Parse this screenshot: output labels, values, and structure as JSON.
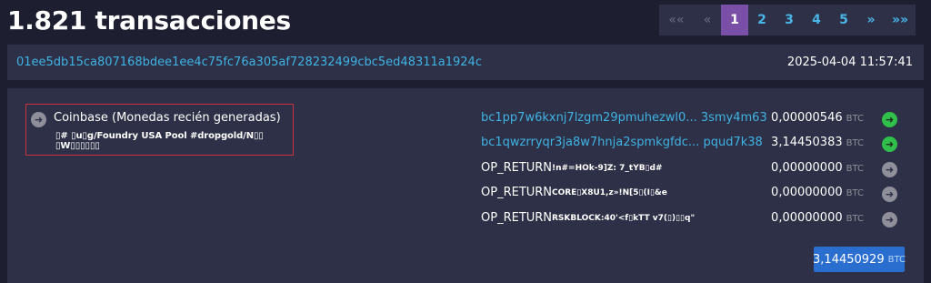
{
  "header": {
    "title": "1.821 transacciones"
  },
  "pagination": {
    "first": "««",
    "prev": "«",
    "pages": [
      "1",
      "2",
      "3",
      "4",
      "5"
    ],
    "active_page": "1",
    "next": "»",
    "last": "»»"
  },
  "transaction": {
    "txid": "01ee5db15ca807168bdee1ee4c75fc76a305af728232499cbc5ed48311a1924c",
    "timestamp": "2025-04-04 11:57:41",
    "input": {
      "label": "Coinbase (Monedas recién generadas)",
      "script": "▯# ▯u▯g/Foundry USA Pool #dropgold/N▯▯ ▯W▯▯▯▯▯▯"
    },
    "outputs": [
      {
        "kind": "address",
        "address": "bc1pp7w6kxnj7lzgm29pmuhezwl0... 3smy4m63",
        "amount": "0,00000546",
        "unit": "BTC",
        "arrow": "green"
      },
      {
        "kind": "address",
        "address": "bc1qwzrryqr3ja8w7hnja2spmkgfdc... pqud7k38",
        "amount": "3,14450383",
        "unit": "BTC",
        "arrow": "green"
      },
      {
        "kind": "op_return",
        "label": "OP_RETURN",
        "data": "!n#=HOk-9]Z:  7_tYB▯d#",
        "amount": "0,00000000",
        "unit": "BTC",
        "arrow": "grey"
      },
      {
        "kind": "op_return",
        "label": "OP_RETURN",
        "data": "CORE▯X8U1,z»!N[5▯(I▯&e",
        "amount": "0,00000000",
        "unit": "BTC",
        "arrow": "grey"
      },
      {
        "kind": "op_return",
        "label": "OP_RETURN",
        "data": "RSKBLOCK:40'<f▯kTT v7(▯)▯▯q\"",
        "amount": "0,00000000",
        "unit": "BTC",
        "arrow": "grey"
      }
    ],
    "total": {
      "amount": "3,14450929",
      "unit": "BTC"
    }
  },
  "colors": {
    "background": "#1d1f31",
    "panel": "#2d3046",
    "link": "#3fb3e4",
    "active_page": "#7a4fa8",
    "green_arrow": "#2fbf4a",
    "grey_arrow": "#8f8f9b",
    "highlight_border": "#c6323a",
    "total_badge": "#2a6fcf"
  }
}
